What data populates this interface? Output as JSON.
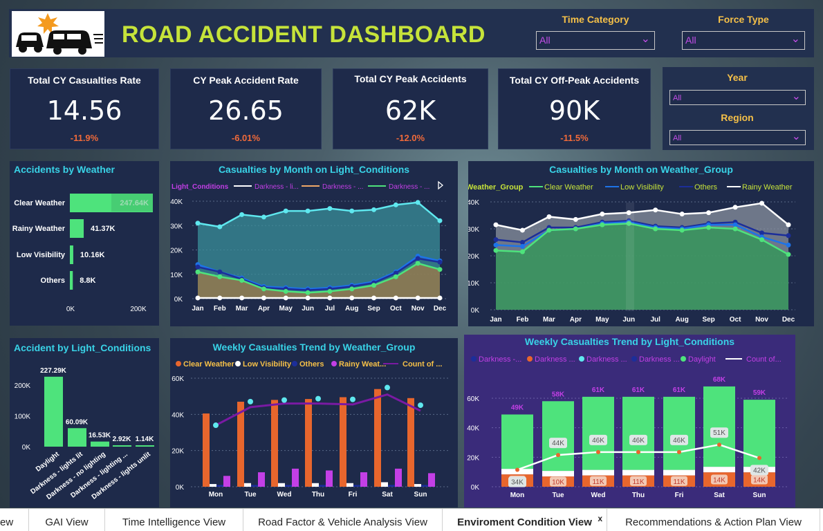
{
  "header": {
    "title": "ROAD ACCIDENT DASHBOARD"
  },
  "filters": {
    "time_category": {
      "label": "Time Category",
      "value": "All"
    },
    "force_type": {
      "label": "Force Type",
      "value": "All"
    },
    "year": {
      "label": "Year",
      "value": "All"
    },
    "region": {
      "label": "Region",
      "value": "All"
    }
  },
  "kpis": [
    {
      "label": "Total CY Casualties Rate",
      "value": "14.56",
      "delta": "-11.9%"
    },
    {
      "label": "CY Peak Accident Rate",
      "value": "26.65",
      "delta": "-6.01%"
    },
    {
      "label": "Total CY Peak Accidents",
      "value": "62K",
      "delta": "-12.0%"
    },
    {
      "label": "Total CY Off-Peak Accidents",
      "value": "90K",
      "delta": "-11.5%"
    }
  ],
  "colors": {
    "green": "#4ee37c",
    "cyan": "#5fe8ef",
    "blue": "#1d73e8",
    "navy": "#1c2e9a",
    "orange": "#e8662d",
    "white": "#ffffff",
    "purple": "#c33fe6",
    "darkpurple": "#7a1aa3",
    "peach": "#f0a868"
  },
  "charts": {
    "weather": {
      "title": "Accidents by Weather",
      "categories": [
        "Clear Weather",
        "Rainy Weather",
        "Low Visibility",
        "Others"
      ],
      "values": [
        247.64,
        41.37,
        10.16,
        8.8
      ],
      "labels": [
        "247.64K",
        "41.37K",
        "10.16K",
        "8.8K"
      ],
      "xticks": [
        "0K",
        "200K"
      ]
    },
    "light": {
      "title": "Accident by Light_Conditions",
      "categories": [
        "Daylight",
        "Darkness - lights lit",
        "Darkness - no lighting",
        "Darkness - lighting ...",
        "Darkness - lights unlit"
      ],
      "values": [
        227.29,
        60.09,
        16.53,
        2.92,
        1.14
      ],
      "labels": [
        "227.29K",
        "60.09K",
        "16.53K",
        "2.92K",
        "1.14K"
      ],
      "yticks": [
        "200K",
        "100K",
        "0K"
      ]
    },
    "monthLight": {
      "title": "Casualties by Month on Light_Conditions",
      "legend_title": "Light_Conditions",
      "legend": [
        "Darkness - li...",
        "Darkness - ...",
        "Darkness - ..."
      ],
      "months": [
        "Jan",
        "Feb",
        "Mar",
        "Apr",
        "May",
        "Jun",
        "Jul",
        "Aug",
        "Sep",
        "Oct",
        "Nov",
        "Dec"
      ],
      "yticks": [
        "40K",
        "30K",
        "20K",
        "10K",
        "0K"
      ]
    },
    "monthWeather": {
      "title": "Casualties by Month on Weather_Group",
      "legend_title": "Weather_Group",
      "legend": [
        "Clear Weather",
        "Low Visibility",
        "Others",
        "Rainy Weather"
      ],
      "months": [
        "Jan",
        "Feb",
        "Mar",
        "Apr",
        "May",
        "Jun",
        "Jul",
        "Aug",
        "Sep",
        "Oct",
        "Nov",
        "Dec"
      ],
      "yticks": [
        "40K",
        "30K",
        "20K",
        "10K",
        "0K"
      ]
    },
    "weeklyWeather": {
      "title": "Weekly Casualties Trend by Weather_Group",
      "legend": [
        "Clear Weather",
        "Low Visibility",
        "Others",
        "Rainy Weat...",
        "Count of ..."
      ],
      "days": [
        "Mon",
        "Tue",
        "Wed",
        "Thu",
        "Fri",
        "Sat",
        "Sun"
      ],
      "yticks": [
        "60K",
        "40K",
        "20K",
        "0K"
      ]
    },
    "weeklyLight": {
      "title": "Weekly Casualties Trend by Light_Conditions",
      "legend": [
        "Darkness -...",
        "Darkness ...",
        "Darkness ...",
        "Darkness ...",
        "Daylight",
        "Count of..."
      ],
      "days": [
        "Mon",
        "Tue",
        "Wed",
        "Thu",
        "Fri",
        "Sat",
        "Sun"
      ],
      "yticks": [
        "60K",
        "40K",
        "20K",
        "0K"
      ],
      "totals": [
        "49K",
        "58K",
        "61K",
        "61K",
        "61K",
        "68K",
        "59K"
      ],
      "daylight_labels": [
        "34K",
        "44K",
        "46K",
        "46K",
        "46K",
        "51K",
        "42K"
      ],
      "orange_labels": [
        "12K",
        "10K",
        "11K",
        "11K",
        "11K",
        "14K",
        "14K"
      ]
    }
  },
  "chart_data": [
    {
      "type": "bar",
      "title": "Accidents by Weather",
      "categories": [
        "Clear Weather",
        "Rainy Weather",
        "Low Visibility",
        "Others"
      ],
      "values": [
        247640,
        41370,
        10160,
        8800
      ]
    },
    {
      "type": "bar",
      "title": "Accident by Light_Conditions",
      "categories": [
        "Daylight",
        "Darkness - lights lit",
        "Darkness - no lighting",
        "Darkness - lighting ...",
        "Darkness - lights unlit"
      ],
      "values": [
        227290,
        60090,
        16530,
        2920,
        1140
      ]
    },
    {
      "type": "area",
      "title": "Casualties by Month on Light_Conditions",
      "x": [
        "Jan",
        "Feb",
        "Mar",
        "Apr",
        "May",
        "Jun",
        "Jul",
        "Aug",
        "Sep",
        "Oct",
        "Nov",
        "Dec"
      ],
      "ylim": [
        0,
        40000
      ],
      "series": [
        {
          "name": "Darkness - li...",
          "values": [
            31000,
            29500,
            34500,
            33500,
            36000,
            36000,
            37000,
            36000,
            36500,
            38500,
            39500,
            32000
          ]
        },
        {
          "name": "Darkness - ...",
          "values": [
            14000,
            11000,
            8500,
            5000,
            4500,
            4000,
            4500,
            5500,
            7000,
            11000,
            17500,
            15500
          ]
        },
        {
          "name": "Darkness - ...",
          "values": [
            13000,
            11000,
            8000,
            4500,
            4000,
            3500,
            4000,
            5000,
            6500,
            10500,
            16500,
            15000
          ]
        },
        {
          "values": [
            11000,
            9000,
            7500,
            4000,
            3000,
            2500,
            3000,
            4000,
            5500,
            9000,
            14500,
            12000
          ]
        },
        {
          "values": [
            300,
            300,
            300,
            300,
            300,
            300,
            300,
            300,
            300,
            300,
            300,
            300
          ]
        }
      ]
    },
    {
      "type": "area",
      "title": "Casualties by Month on Weather_Group",
      "x": [
        "Jan",
        "Feb",
        "Mar",
        "Apr",
        "May",
        "Jun",
        "Jul",
        "Aug",
        "Sep",
        "Oct",
        "Nov",
        "Dec"
      ],
      "ylim": [
        0,
        40000
      ],
      "series": [
        {
          "name": "Clear Weather",
          "values": [
            22000,
            21500,
            29500,
            30000,
            31500,
            32000,
            30000,
            29500,
            30500,
            30000,
            26000,
            20500
          ]
        },
        {
          "name": "Low Visibility",
          "values": [
            24000,
            23500,
            29500,
            30000,
            32000,
            32500,
            30500,
            30000,
            31500,
            31500,
            27000,
            24000
          ]
        },
        {
          "name": "Others",
          "values": [
            26000,
            25000,
            30500,
            30500,
            32500,
            33000,
            31000,
            30500,
            32000,
            32500,
            28500,
            27500
          ]
        },
        {
          "name": "Rainy Weather",
          "values": [
            31500,
            29500,
            34500,
            33500,
            35500,
            36000,
            37000,
            35500,
            36000,
            38000,
            39500,
            31500
          ]
        }
      ]
    },
    {
      "type": "bar",
      "title": "Weekly Casualties Trend by Weather_Group",
      "x": [
        "Mon",
        "Tue",
        "Wed",
        "Thu",
        "Fri",
        "Sat",
        "Sun"
      ],
      "ylim": [
        0,
        60000
      ],
      "series": [
        {
          "name": "Clear Weather",
          "values": [
            40500,
            47000,
            48000,
            48500,
            49500,
            54000,
            49000
          ]
        },
        {
          "name": "Low Visibility",
          "values": [
            1500,
            2000,
            2000,
            2000,
            2000,
            2500,
            1500
          ]
        },
        {
          "name": "Others",
          "values": [
            1000,
            1000,
            1000,
            1000,
            1000,
            1000,
            1000
          ]
        },
        {
          "name": "Rainy Weat...",
          "values": [
            6000,
            8000,
            10000,
            9000,
            8000,
            10000,
            7500
          ]
        },
        {
          "name": "Count of ...",
          "values": [
            34000,
            44000,
            46000,
            46000,
            45500,
            51000,
            42000
          ]
        },
        {
          "values": [
            34000,
            44000,
            46000,
            46000,
            46000,
            51000,
            42000
          ]
        }
      ]
    },
    {
      "type": "bar",
      "title": "Weekly Casualties Trend by Light_Conditions",
      "x": [
        "Mon",
        "Tue",
        "Wed",
        "Thu",
        "Fri",
        "Sat",
        "Sun"
      ],
      "ylim": [
        0,
        60000
      ],
      "series": [
        {
          "name": "Darkness ...",
          "values": [
            12000,
            10000,
            11000,
            11000,
            11000,
            14000,
            14000
          ]
        },
        {
          "name": "Daylight",
          "values": [
            34000,
            44000,
            46000,
            46000,
            46000,
            51000,
            42000
          ]
        },
        {
          "name": "Count of...",
          "values": [
            49000,
            58000,
            61000,
            61000,
            61000,
            68000,
            59000
          ]
        }
      ]
    }
  ],
  "tabs": [
    "ew",
    "GAI View",
    "Time Intelligence View",
    "Road Factor & Vehicle Analysis View",
    "Enviroment Condition View",
    "Recommendations & Action Plan View"
  ],
  "tab_close": "x"
}
